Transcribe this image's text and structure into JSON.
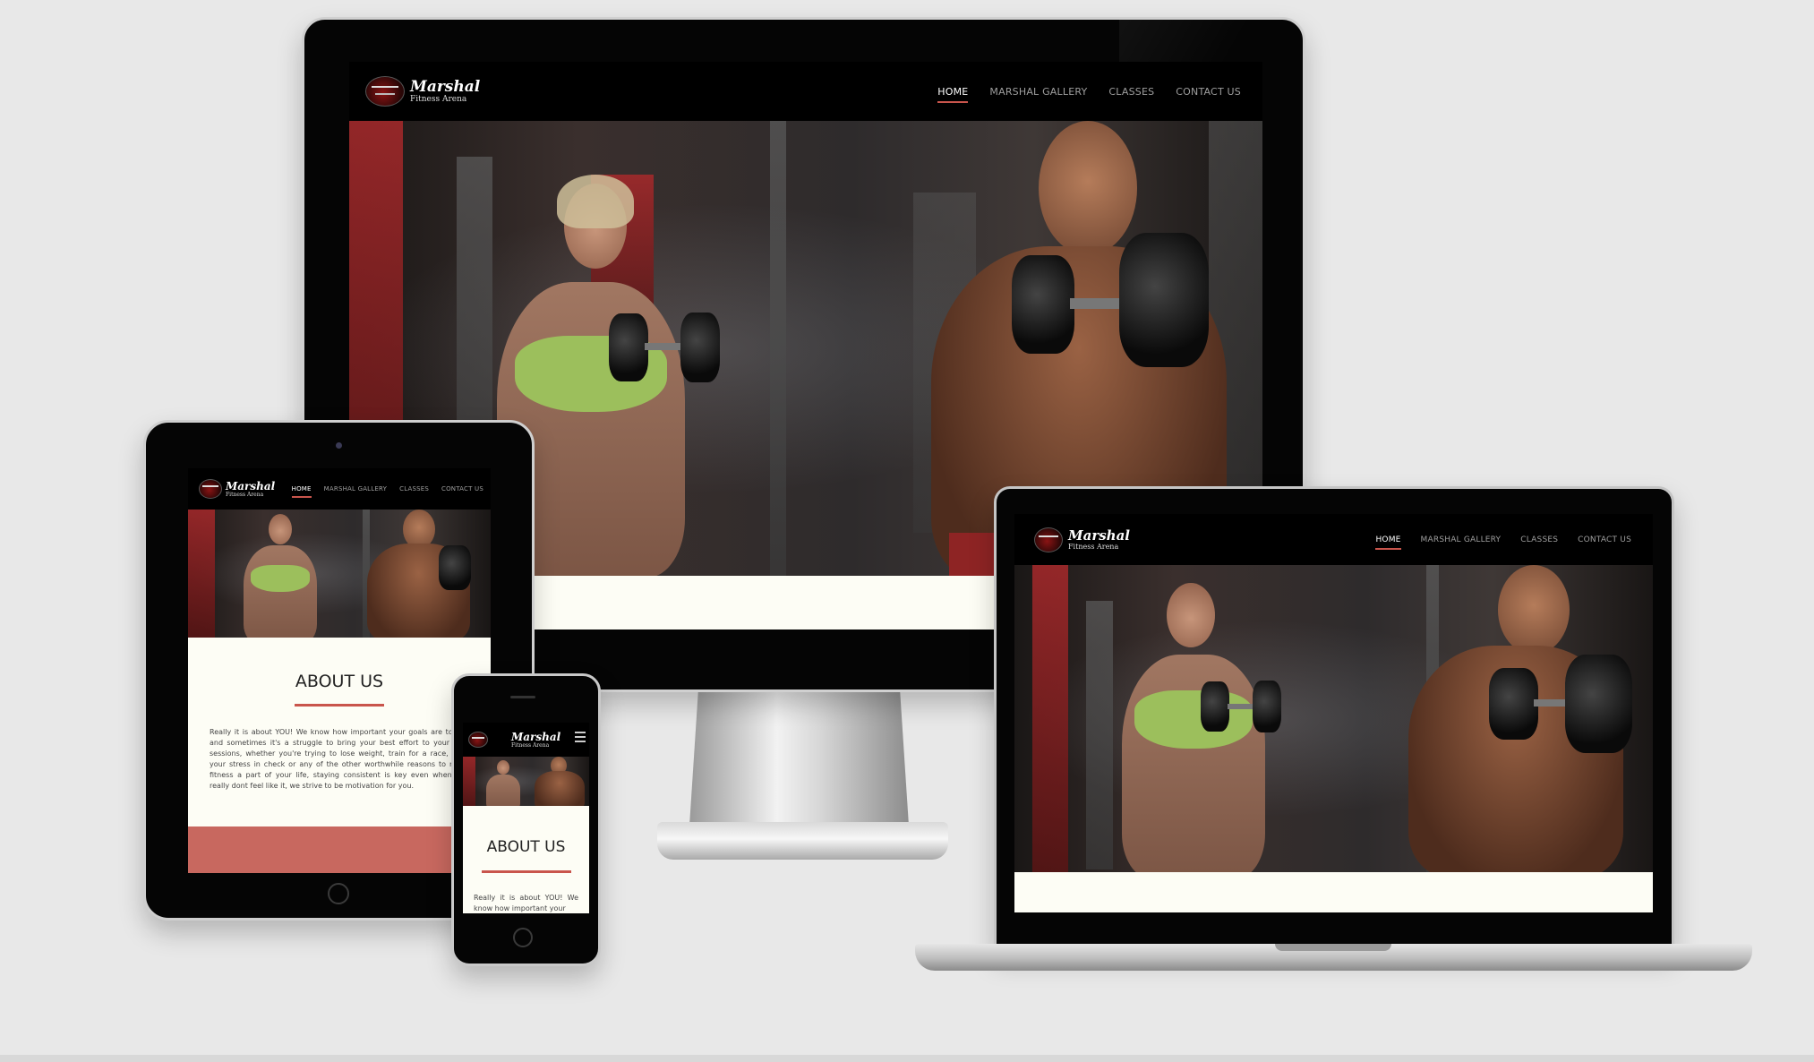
{
  "site": {
    "brand_name": "Marshal",
    "brand_tagline": "Fitness Arena",
    "nav": [
      {
        "label": "HOME",
        "active": true
      },
      {
        "label": "MARSHAL GALLERY",
        "active": false
      },
      {
        "label": "CLASSES",
        "active": false
      },
      {
        "label": "CONTACT US",
        "active": false
      }
    ],
    "about_title": "ABOUT US",
    "about_text_tablet": "Really it is about YOU! We know how important your goals are to you and sometimes it's a struggle to bring your best effort to your gym sessions, whether you're trying to lose weight, train for a race, keep your stress in check or any of the other worthwhile reasons to make fitness a part of your life, staying consistent is key even when you really dont feel like it, we strive to be motivation for you.",
    "about_text_phone": "Really it is about YOU! We know how important your"
  },
  "colors": {
    "accent": "#c9554c",
    "salmon_band": "#c8685f",
    "page_bg": "#e8e8e8",
    "content_bg": "#fdfdf5",
    "header_bg": "#000000"
  },
  "icons": {
    "logo": "dumbbell-crest-icon",
    "menu": "hamburger-menu-icon"
  }
}
